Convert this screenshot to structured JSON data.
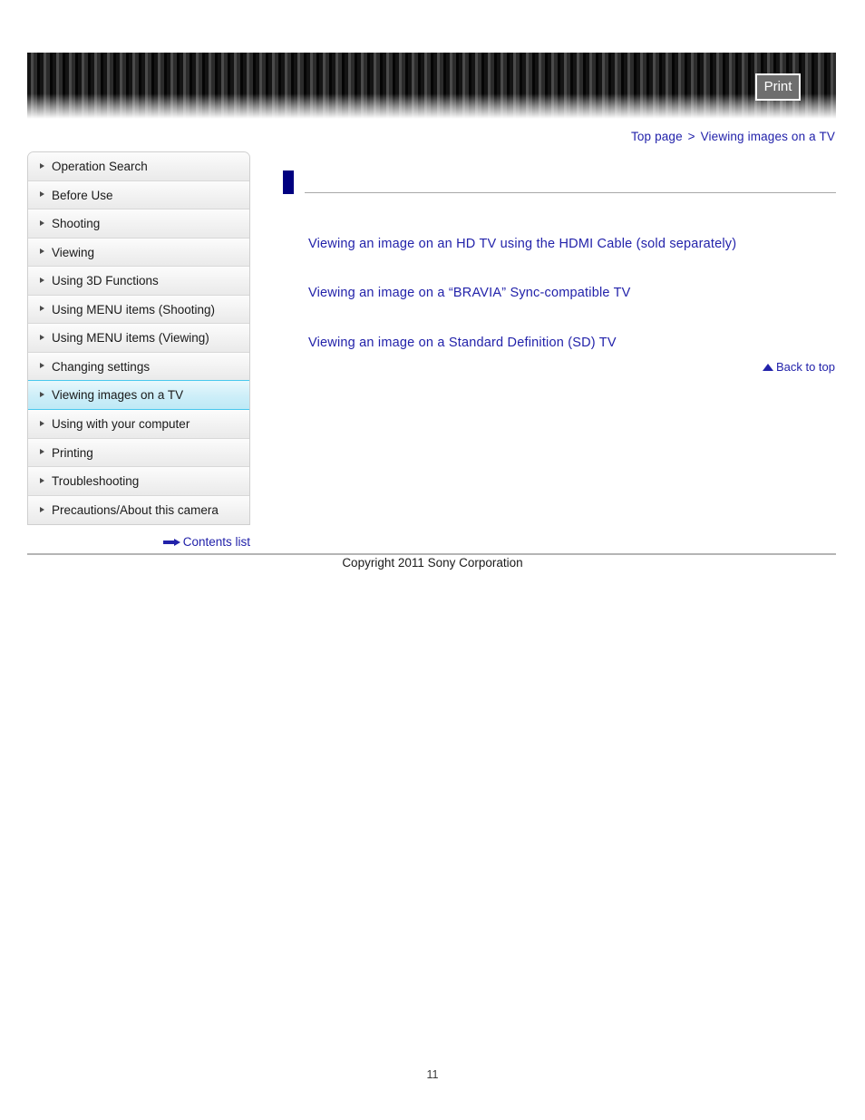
{
  "header": {
    "print_label": "Print",
    "banner_style": "striped-dark-gradient"
  },
  "breadcrumb": {
    "top_page": "Top page",
    "separator": ">",
    "current": "Viewing images on a TV"
  },
  "sidebar": {
    "items": [
      {
        "label": "Operation Search",
        "active": false
      },
      {
        "label": "Before Use",
        "active": false
      },
      {
        "label": "Shooting",
        "active": false
      },
      {
        "label": "Viewing",
        "active": false
      },
      {
        "label": "Using 3D Functions",
        "active": false
      },
      {
        "label": "Using MENU items (Shooting)",
        "active": false
      },
      {
        "label": "Using MENU items (Viewing)",
        "active": false
      },
      {
        "label": "Changing settings",
        "active": false
      },
      {
        "label": "Viewing images on a TV",
        "active": true
      },
      {
        "label": "Using with your computer",
        "active": false
      },
      {
        "label": "Printing",
        "active": false
      },
      {
        "label": "Troubleshooting",
        "active": false
      },
      {
        "label": "Precautions/About this camera",
        "active": false
      }
    ],
    "contents_list_label": "Contents list"
  },
  "main": {
    "title": "",
    "links": [
      "Viewing an image on an HD TV using the HDMI Cable (sold separately)",
      "Viewing an image on a “BRAVIA” Sync-compatible TV",
      "Viewing an image on a Standard Definition (SD) TV"
    ],
    "back_to_top_label": "Back to top"
  },
  "footer": {
    "copyright": "Copyright 2011 Sony Corporation",
    "page_number": "11"
  },
  "colors": {
    "link": "#2222aa",
    "title_marker": "#000080",
    "active_nav_bg": "#cdeef8",
    "active_nav_border": "#48c8ee",
    "rule": "#a8a8a8"
  }
}
